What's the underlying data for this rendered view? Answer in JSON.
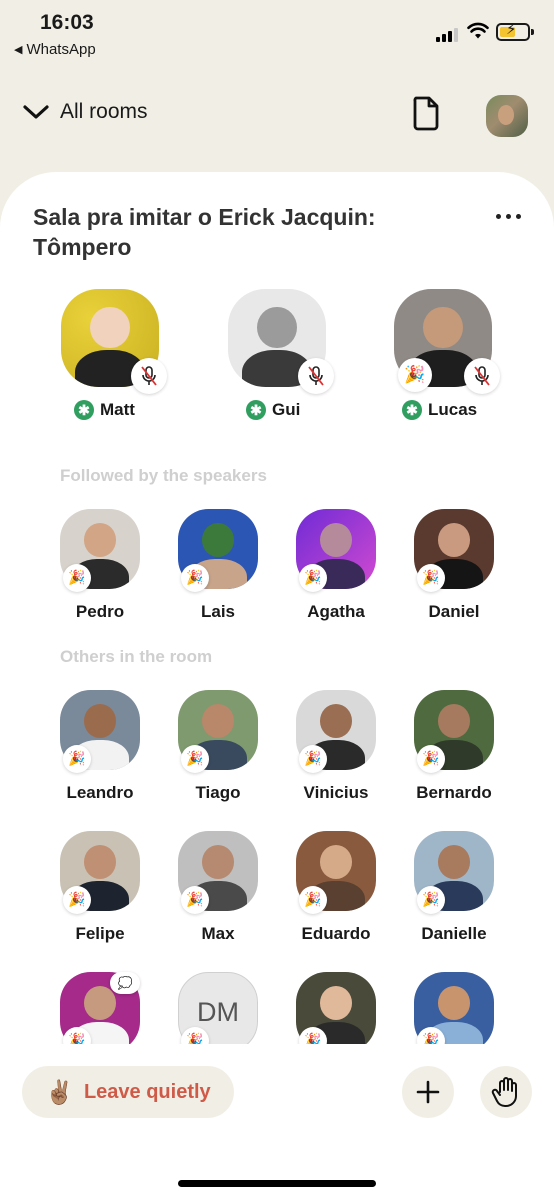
{
  "status_bar": {
    "time": "16:03",
    "back_app": "WhatsApp",
    "icons": [
      "signal-icon",
      "wifi-icon",
      "battery-charging-icon"
    ]
  },
  "header": {
    "all_rooms_label": "All rooms",
    "icons": [
      "chevron-down-icon",
      "document-icon",
      "profile-avatar"
    ]
  },
  "room": {
    "title": "Sala pra imitar o Erick Jacquin: Tômpero",
    "speakers": [
      {
        "name": "Matt",
        "moderator": true,
        "muted": true
      },
      {
        "name": "Gui",
        "moderator": true,
        "muted": true
      },
      {
        "name": "Lucas",
        "moderator": true,
        "muted": true,
        "new_badge": true
      }
    ],
    "followed_label": "Followed by the speakers",
    "followed": [
      {
        "name": "Pedro"
      },
      {
        "name": "Lais"
      },
      {
        "name": "Agatha"
      },
      {
        "name": "Daniel"
      }
    ],
    "others_label": "Others in the room",
    "others": [
      {
        "name": "Leandro"
      },
      {
        "name": "Tiago"
      },
      {
        "name": "Vinicius"
      },
      {
        "name": "Bernardo"
      },
      {
        "name": "Felipe"
      },
      {
        "name": "Max"
      },
      {
        "name": "Eduardo"
      },
      {
        "name": "Danielle"
      },
      {
        "name": ""
      },
      {
        "name": "",
        "initials": "DM"
      },
      {
        "name": ""
      },
      {
        "name": ""
      }
    ]
  },
  "bottom": {
    "leave_label": "Leave quietly",
    "icons": [
      "victory-hand-icon",
      "plus-icon",
      "raise-hand-icon"
    ]
  },
  "colors": {
    "background": "#f1efe5",
    "card": "#ffffff",
    "leave_text": "#d05a48",
    "moderator_green": "#2f9e5e",
    "section_label": "#cfcfcf"
  }
}
